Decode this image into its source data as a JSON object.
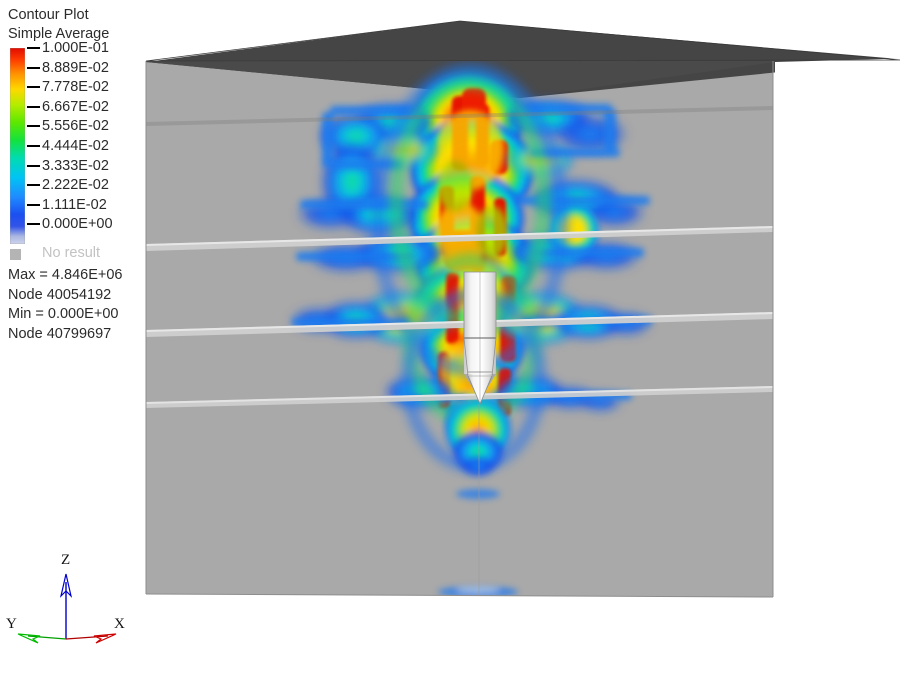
{
  "legend": {
    "title_line1": "Contour Plot",
    "title_line2": "Simple Average",
    "levels": [
      {
        "label": "1.000E-01",
        "value": 0.1,
        "color": "#ee2200"
      },
      {
        "label": "8.889E-02",
        "value": 0.08889,
        "color": "#ff6a00"
      },
      {
        "label": "7.778E-02",
        "value": 0.07778,
        "color": "#ffc400"
      },
      {
        "label": "6.667E-02",
        "value": 0.06667,
        "color": "#d7e800"
      },
      {
        "label": "5.556E-02",
        "value": 0.05556,
        "color": "#4ee400"
      },
      {
        "label": "4.444E-02",
        "value": 0.04444,
        "color": "#00e06a"
      },
      {
        "label": "3.333E-02",
        "value": 0.03333,
        "color": "#00ddd2"
      },
      {
        "label": "2.222E-02",
        "value": 0.02222,
        "color": "#1f9bff"
      },
      {
        "label": "1.111E-02",
        "value": 0.01111,
        "color": "#1b4ff0"
      },
      {
        "label": "0.000E+00",
        "value": 0.0,
        "color": "#b9c4e6"
      }
    ],
    "no_result_label": "No result",
    "no_result_color": "#b4b4b4",
    "stats": [
      "Max = 4.846E+06",
      "Node 40054192",
      "Min = 0.000E+00",
      "Node 40799697"
    ]
  },
  "triad": {
    "axes": [
      {
        "name": "Z",
        "label": "Z",
        "color": "#0000cc"
      },
      {
        "name": "X",
        "label": "X",
        "color": "#cc0000"
      },
      {
        "name": "Y",
        "label": "Y",
        "color": "#00aa00"
      }
    ],
    "origin_label": ""
  },
  "scene": {
    "background": "#ffffff",
    "box_front_color": "#a9a9a9",
    "box_top_color": "#4a4a4a",
    "box_right_color": "#9a9a9a",
    "penetrator_color": "#f0f0f0",
    "layer_color": "#c9c9c9"
  },
  "chart_data": {
    "type": "heatmap",
    "title": "Contour Plot",
    "subtitle": "Simple Average",
    "colormap": "rainbow",
    "levels": [
      0.0,
      0.01111,
      0.02222,
      0.03333,
      0.04444,
      0.05556,
      0.06667,
      0.07778,
      0.08889,
      0.1
    ],
    "level_labels": [
      "0.000E+00",
      "1.111E-02",
      "2.222E-02",
      "3.333E-02",
      "4.444E-02",
      "5.556E-02",
      "6.667E-02",
      "7.778E-02",
      "8.889E-02",
      "1.000E-01"
    ],
    "clim": [
      0.0,
      0.1
    ],
    "max_value": 4846000.0,
    "max_value_label": "4.846E+06",
    "max_node": "40054192",
    "min_value": 0.0,
    "min_value_label": "0.000E+00",
    "min_node": "40799697",
    "no_result_label": "No result",
    "legend_position": "top-left",
    "grid": false,
    "xlabel": "",
    "ylabel": ""
  }
}
